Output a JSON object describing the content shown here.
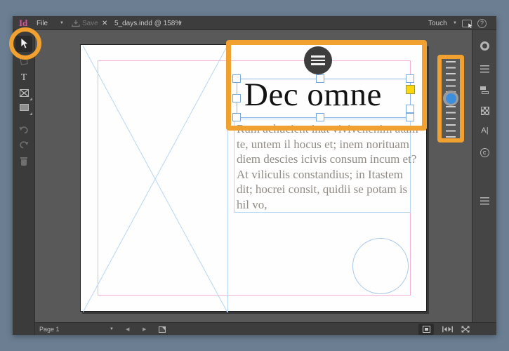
{
  "title_bar": {
    "logo": "Id",
    "file_menu": "File",
    "save_label": "Save",
    "tab_title": "5_days.indd @ 158%",
    "workspace_label": "Touch"
  },
  "glyphs": {
    "dropdown": "▼",
    "close": "✕",
    "help": "?",
    "prev": "◀",
    "next": "▶"
  },
  "tools_left": {
    "type_tool_label": "T"
  },
  "panel_right": {
    "character_panel_label": "A|"
  },
  "page": {
    "title_text": "Dec omne",
    "body_lines": [
      "Rum achucient inat vivivenenim atam",
      "te, untem il hocus et; inem norituam",
      "diem descies icivis consum incum et?",
      "At viliculis constandius; in Itastem",
      "dit; hocrei consit, quidii se potam is",
      "hil vo,"
    ]
  },
  "bottom_bar": {
    "page_indicator": "Page 1"
  },
  "colors": {
    "annotation_orange": "#f0a12f",
    "brand_magenta": "#e0509e",
    "selection_blue": "#7fb2e8",
    "margin_guide_pink": "#f4b2da",
    "frame_guide_blue": "#b9d5f4",
    "slider_thumb_blue": "#3e8ede",
    "corner_handle_yellow": "#ffd70a",
    "desktop_background": "#6b7e92"
  }
}
